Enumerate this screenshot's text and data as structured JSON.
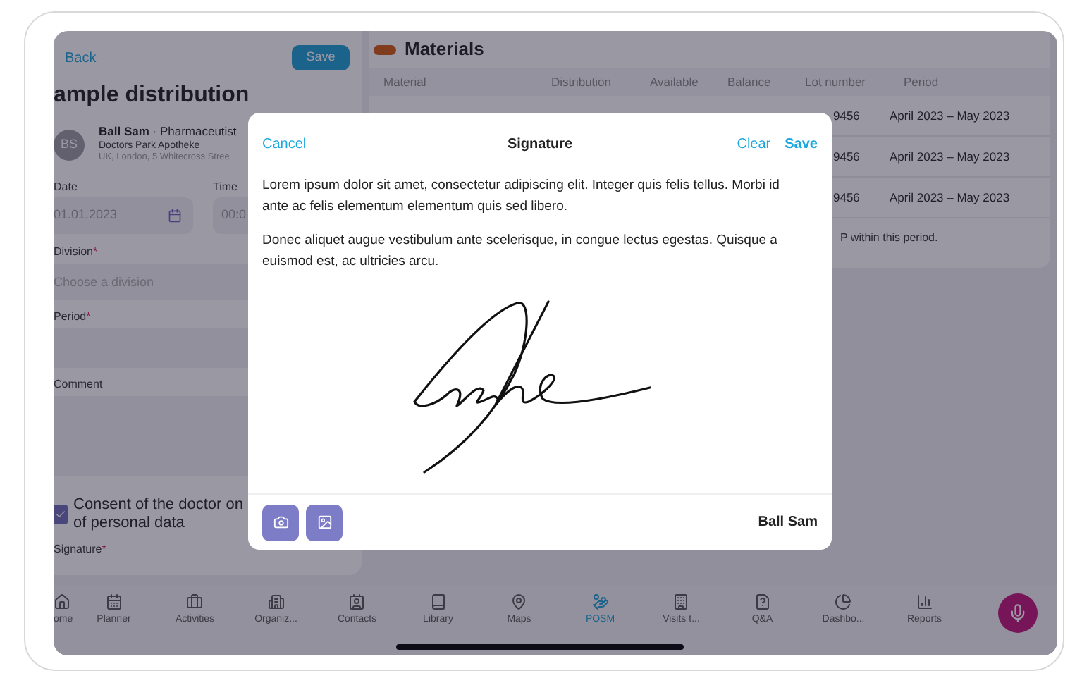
{
  "form": {
    "back": "Back",
    "save": "Save",
    "title": "ample distribution",
    "contact": {
      "initials": "BS",
      "name": "Ball Sam",
      "role": " · Pharmaceutist",
      "org": "Doctors Park Apotheke",
      "address": "UK, London, 5 Whitecross Stree"
    },
    "date": {
      "label": "Date",
      "value": "01.01.2023"
    },
    "time": {
      "label": "Time",
      "value": "00:0"
    },
    "division": {
      "label": "Division",
      "mark": "*",
      "placeholder": "Choose a division"
    },
    "period": {
      "label": "Period",
      "mark": "*"
    },
    "comment": {
      "label": "Comment"
    },
    "consent": {
      "checked": true,
      "line_1": "Consent of the doctor on",
      "line_2": "of personal data"
    },
    "signature": {
      "label": "Signature",
      "mark": "*"
    }
  },
  "materials": {
    "title": "Materials",
    "columns": [
      "Material",
      "Distribution",
      "Available",
      "Balance",
      "Lot number",
      "Period"
    ],
    "rows": [
      {
        "lot_number": "9456",
        "period": "April 2023 – May 2023"
      },
      {
        "lot_number": "9456",
        "period": "April 2023 – May 2023"
      },
      {
        "lot_number": "9456",
        "period": "April 2023 – May 2023"
      }
    ],
    "note": "P within this period."
  },
  "dialog": {
    "cancel": "Cancel",
    "title": "Signature",
    "clear": "Clear",
    "save": "Save",
    "paragraphs": [
      "Lorem ipsum dolor sit amet, consectetur adipiscing elit. Integer quis felis tellus. Morbi id ante ac felis elementum elementum quis sed libero.",
      "Donec aliquet augue vestibulum ante scelerisque, in congue lectus egestas. Quisque a euismod est, ac ultricies arcu."
    ],
    "signer": "Ball Sam"
  },
  "nav": [
    {
      "label": "ome",
      "kind": "home",
      "selected": false
    },
    {
      "label": "Planner",
      "kind": "planner",
      "selected": false
    },
    {
      "label": "Activities",
      "kind": "activities",
      "selected": false
    },
    {
      "label": "Organiz...",
      "kind": "organizations",
      "selected": false
    },
    {
      "label": "Contacts",
      "kind": "contacts",
      "selected": false
    },
    {
      "label": "Library",
      "kind": "library",
      "selected": false
    },
    {
      "label": "Maps",
      "kind": "maps",
      "selected": false
    },
    {
      "label": "POSM",
      "kind": "posm",
      "selected": true
    },
    {
      "label": "Visits t...",
      "kind": "visits",
      "selected": false
    },
    {
      "label": "Q&A",
      "kind": "qa",
      "selected": false
    },
    {
      "label": "Dashbo...",
      "kind": "dashboard",
      "selected": false
    },
    {
      "label": "Reports",
      "kind": "reports",
      "selected": false
    }
  ]
}
